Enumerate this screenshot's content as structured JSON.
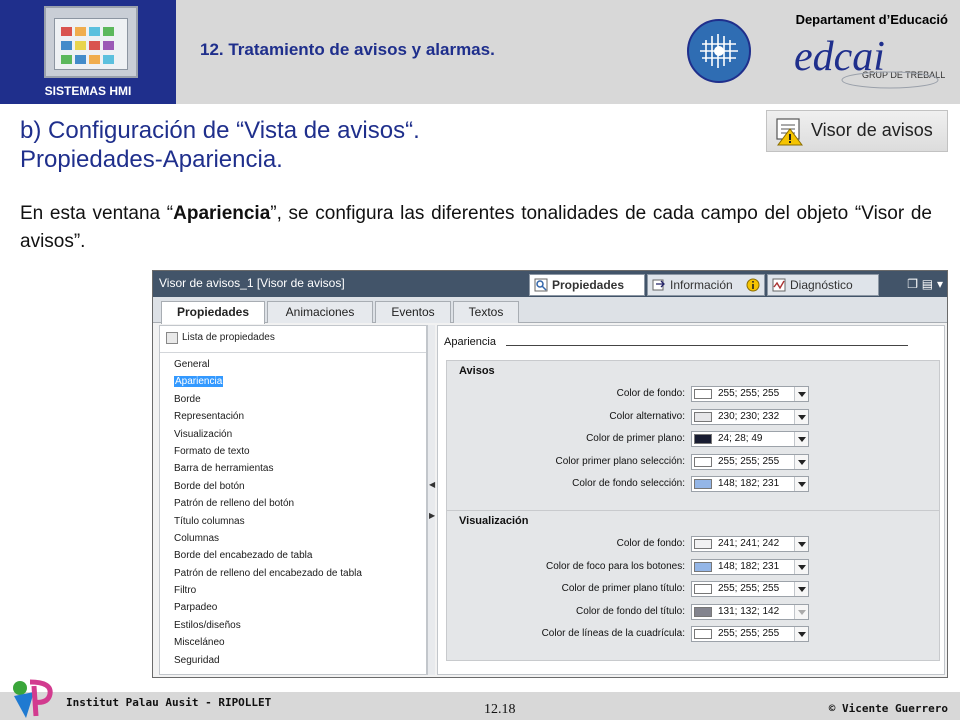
{
  "header": {
    "hmi_label": "SISTEMAS HMI",
    "topic": "12. Tratamiento de avisos y alarmas.",
    "department": "Departament d’Educació",
    "logo_text": "edcai",
    "logo_sub": "GRUP DE TREBALL"
  },
  "slide": {
    "title_line1": "b) Configuración de “Vista de avisos“.",
    "title_line2": "Propiedades-Apariencia.",
    "badge_label": "Visor de avisos",
    "body_before": "En esta ventana “",
    "body_bold": "Apariencia",
    "body_after": "”, se configura las diferentes tonalidades de cada campo del objeto “Visor de avisos”."
  },
  "window": {
    "title": "Visor de avisos_1 [Visor de avisos]",
    "inspector_tabs": [
      "Propiedades",
      "Información",
      "Diagnóstico"
    ],
    "prop_tabs": [
      "Propiedades",
      "Animaciones",
      "Eventos",
      "Textos"
    ],
    "property_list_header": "Lista de propiedades",
    "property_list": [
      "General",
      "Apariencia",
      "Borde",
      "Representación",
      "Visualización",
      "Formato de texto",
      "Barra de herramientas",
      "Borde del botón",
      "Patrón de relleno del botón",
      "Título columnas",
      "Columnas",
      "Borde del encabezado de tabla",
      "Patrón de relleno del encabezado de tabla",
      "Filtro",
      "Parpadeo",
      "Estilos/diseños",
      "Misceláneo",
      "Seguridad"
    ],
    "selected_index": 1,
    "section_title": "Apariencia",
    "groups": [
      {
        "title": "Avisos",
        "rows": [
          {
            "label": "Color de fondo:",
            "value": "255; 255; 255",
            "color": "#ffffff"
          },
          {
            "label": "Color alternativo:",
            "value": "230; 230; 232",
            "color": "#e6e6e8"
          },
          {
            "label": "Color de primer plano:",
            "value": "24; 28; 49",
            "color": "#181c31"
          },
          {
            "label": "Color primer plano selección:",
            "value": "255; 255; 255",
            "color": "#ffffff"
          },
          {
            "label": "Color de fondo selección:",
            "value": "148; 182; 231",
            "color": "#94b6e7"
          }
        ]
      },
      {
        "title": "Visualización",
        "rows": [
          {
            "label": "Color de fondo:",
            "value": "241; 241; 242",
            "color": "#f1f1f2"
          },
          {
            "label": "Color de foco para los botones:",
            "value": "148; 182; 231",
            "color": "#94b6e7"
          },
          {
            "label": "Color de primer plano título:",
            "value": "255; 255; 255",
            "color": "#ffffff"
          },
          {
            "label": "Color de fondo del título:",
            "value": "131; 132; 142",
            "color": "#83848e"
          },
          {
            "label": "Color de líneas de la cuadrícula:",
            "value": "255; 255; 255",
            "color": "#ffffff"
          }
        ]
      }
    ]
  },
  "footer": {
    "institute": "Institut Palau Ausit - RIPOLLET",
    "page": "12.18",
    "copyright": "© Vicente Guerrero"
  },
  "colors": {
    "accent_blue": "#1f2f8c",
    "header_gray": "#d8d8d8",
    "window_top": "#425469",
    "selection": "#3399ff"
  }
}
